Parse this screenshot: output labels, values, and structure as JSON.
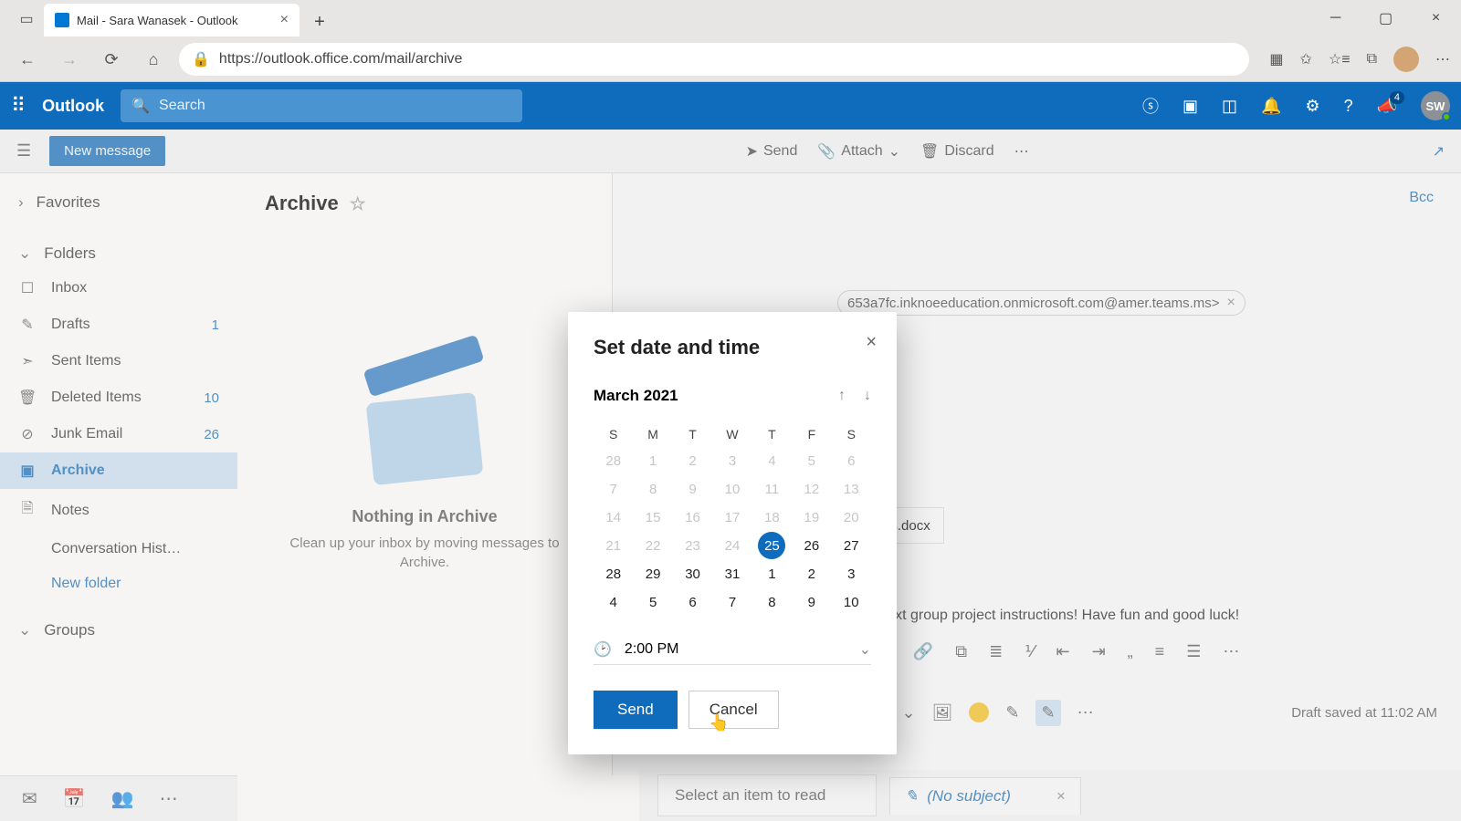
{
  "browser": {
    "tab_title": "Mail - Sara Wanasek - Outlook",
    "url": "https://outlook.office.com/mail/archive"
  },
  "app": {
    "name": "Outlook",
    "search_placeholder": "Search",
    "notif_badge": "4",
    "avatar_initials": "SW"
  },
  "toolbar": {
    "new_message": "New message",
    "send": "Send",
    "attach": "Attach",
    "discard": "Discard"
  },
  "sidebar": {
    "favorites": "Favorites",
    "folders": "Folders",
    "items": [
      {
        "label": "Inbox",
        "count": ""
      },
      {
        "label": "Drafts",
        "count": "1"
      },
      {
        "label": "Sent Items",
        "count": ""
      },
      {
        "label": "Deleted Items",
        "count": "10"
      },
      {
        "label": "Junk Email",
        "count": "26"
      },
      {
        "label": "Archive",
        "count": ""
      },
      {
        "label": "Notes",
        "count": ""
      },
      {
        "label": "Conversation Hist…",
        "count": ""
      }
    ],
    "new_folder": "New folder",
    "groups": "Groups"
  },
  "archive_pane": {
    "title": "Archive",
    "empty_title": "Nothing in Archive",
    "empty_body": "Clean up your inbox by moving messages to Archive."
  },
  "compose": {
    "bcc": "Bcc",
    "recipient": "653a7fc.inknoeeducation.onmicrosoft.com@amer.teams.ms>",
    "attachment": "ons.docx",
    "body_text": "r your next group project instructions! Have fun and good luck!",
    "send": "Send",
    "discard": "Discard",
    "draft_saved": "Draft saved at 11:02 AM"
  },
  "reading": {
    "prompt": "Select an item to read",
    "no_subject": "(No subject)"
  },
  "modal": {
    "title": "Set date and time",
    "month": "March 2021",
    "dow": [
      "S",
      "M",
      "T",
      "W",
      "T",
      "F",
      "S"
    ],
    "weeks": [
      [
        {
          "d": "28",
          "dim": true
        },
        {
          "d": "1",
          "dim": true
        },
        {
          "d": "2",
          "dim": true
        },
        {
          "d": "3",
          "dim": true
        },
        {
          "d": "4",
          "dim": true
        },
        {
          "d": "5",
          "dim": true
        },
        {
          "d": "6",
          "dim": true
        }
      ],
      [
        {
          "d": "7",
          "dim": true
        },
        {
          "d": "8",
          "dim": true
        },
        {
          "d": "9",
          "dim": true
        },
        {
          "d": "10",
          "dim": true
        },
        {
          "d": "11",
          "dim": true
        },
        {
          "d": "12",
          "dim": true
        },
        {
          "d": "13",
          "dim": true
        }
      ],
      [
        {
          "d": "14",
          "dim": true
        },
        {
          "d": "15",
          "dim": true
        },
        {
          "d": "16",
          "dim": true
        },
        {
          "d": "17",
          "dim": true
        },
        {
          "d": "18",
          "dim": true
        },
        {
          "d": "19",
          "dim": true
        },
        {
          "d": "20",
          "dim": true
        }
      ],
      [
        {
          "d": "21",
          "dim": true
        },
        {
          "d": "22",
          "dim": true
        },
        {
          "d": "23",
          "dim": true
        },
        {
          "d": "24",
          "dim": true
        },
        {
          "d": "25",
          "dim": false,
          "sel": true
        },
        {
          "d": "26",
          "dim": false
        },
        {
          "d": "27",
          "dim": false
        }
      ],
      [
        {
          "d": "28",
          "dim": false
        },
        {
          "d": "29",
          "dim": false
        },
        {
          "d": "30",
          "dim": false
        },
        {
          "d": "31",
          "dim": false
        },
        {
          "d": "1",
          "dim": false
        },
        {
          "d": "2",
          "dim": false
        },
        {
          "d": "3",
          "dim": false
        }
      ],
      [
        {
          "d": "4",
          "dim": false
        },
        {
          "d": "5",
          "dim": false
        },
        {
          "d": "6",
          "dim": false
        },
        {
          "d": "7",
          "dim": false
        },
        {
          "d": "8",
          "dim": false
        },
        {
          "d": "9",
          "dim": false
        },
        {
          "d": "10",
          "dim": false
        }
      ]
    ],
    "time": "2:00 PM",
    "send": "Send",
    "cancel": "Cancel"
  }
}
